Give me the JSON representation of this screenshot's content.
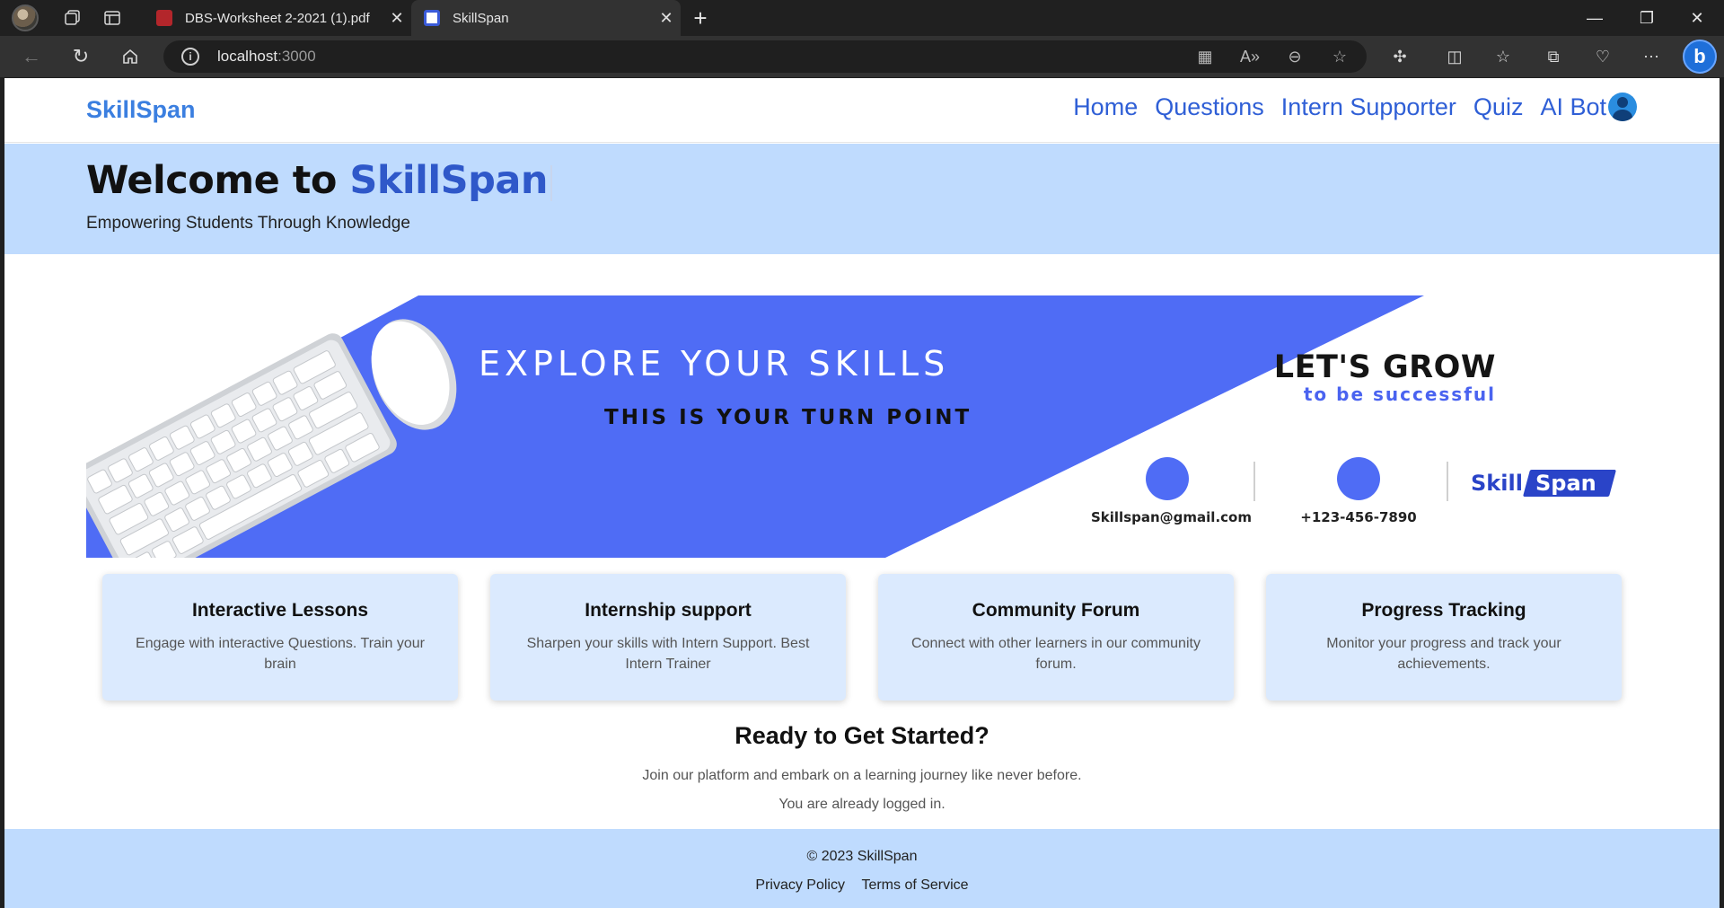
{
  "browser": {
    "tabs": [
      {
        "title": "DBS-Worksheet 2-2021 (1).pdf",
        "active": false
      },
      {
        "title": "SkillSpan",
        "active": true
      }
    ],
    "address": {
      "host": "localhost",
      "port": ":3000"
    }
  },
  "navbar": {
    "brand": "SkillSpan",
    "links": [
      "Home",
      "Questions",
      "Intern Supporter",
      "Quiz",
      "AI Bot"
    ]
  },
  "hero": {
    "title_prefix": "Welcome to ",
    "title_brand": "SkillSpan",
    "subtitle": "Empowering Students Through Knowledge"
  },
  "banner": {
    "headline": "EXPLORE YOUR SKILLS",
    "subline": "THIS IS YOUR TURN POINT",
    "grow_line1": "LET'S GROW",
    "grow_line2": "to be successful",
    "email": "Skillspan@gmail.com",
    "phone": "+123-456-7890",
    "logo_part1": "Skill",
    "logo_part2": "Span",
    "colors": {
      "accent": "#4f6cf5",
      "logo": "#2a44c8"
    }
  },
  "features": [
    {
      "title": "Interactive Lessons",
      "text": "Engage with interactive Questions. Train your brain"
    },
    {
      "title": "Internship support",
      "text": "Sharpen your skills with Intern Support. Best Intern Trainer"
    },
    {
      "title": "Community Forum",
      "text": "Connect with other learners in our community forum."
    },
    {
      "title": "Progress Tracking",
      "text": "Monitor your progress and track your achievements."
    }
  ],
  "cta": {
    "title": "Ready to Get Started?",
    "text": "Join our platform and embark on a learning journey like never before.",
    "status": "You are already logged in."
  },
  "footer": {
    "copyright": "© 2023 SkillSpan",
    "links": [
      "Privacy Policy",
      "Terms of Service"
    ]
  },
  "theme": {
    "light_blue": "#bfdbfe",
    "card_blue": "#dbeafe",
    "link_blue": "#2f5fd6"
  }
}
